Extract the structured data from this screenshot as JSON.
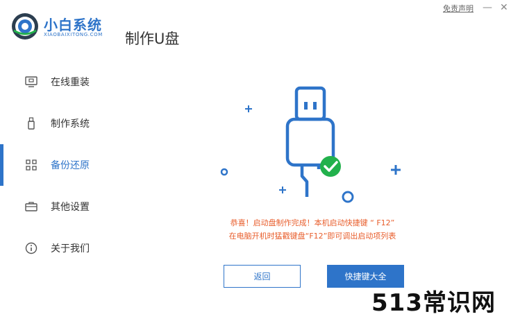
{
  "brand": {
    "name": "小白系统",
    "sub": "XIAOBAIXITONG.COM"
  },
  "page_title": "制作U盘",
  "header": {
    "disclaimer": "免责声明",
    "minimize_glyph": "—",
    "close_glyph": "✕"
  },
  "sidebar": {
    "items": [
      {
        "label": "在线重装",
        "icon": "monitor-icon",
        "active": false
      },
      {
        "label": "制作系统",
        "icon": "usb-drive-icon",
        "active": false
      },
      {
        "label": "备份还原",
        "icon": "grid-icon",
        "active": true
      },
      {
        "label": "其他设置",
        "icon": "briefcase-icon",
        "active": false
      },
      {
        "label": "关于我们",
        "icon": "info-icon",
        "active": false
      }
    ]
  },
  "main": {
    "message_line1": "恭喜！启动盘制作完成！本机启动快捷键 “ F12”",
    "message_line2": "在电脑开机时猛戳键盘“F12”即可调出启动项列表",
    "back_button": "返回",
    "hotkeys_button": "快捷键大全"
  },
  "watermark": "513常识网",
  "colors": {
    "accent": "#2e74c9",
    "success": "#22b14c",
    "message": "#e85d2b"
  }
}
